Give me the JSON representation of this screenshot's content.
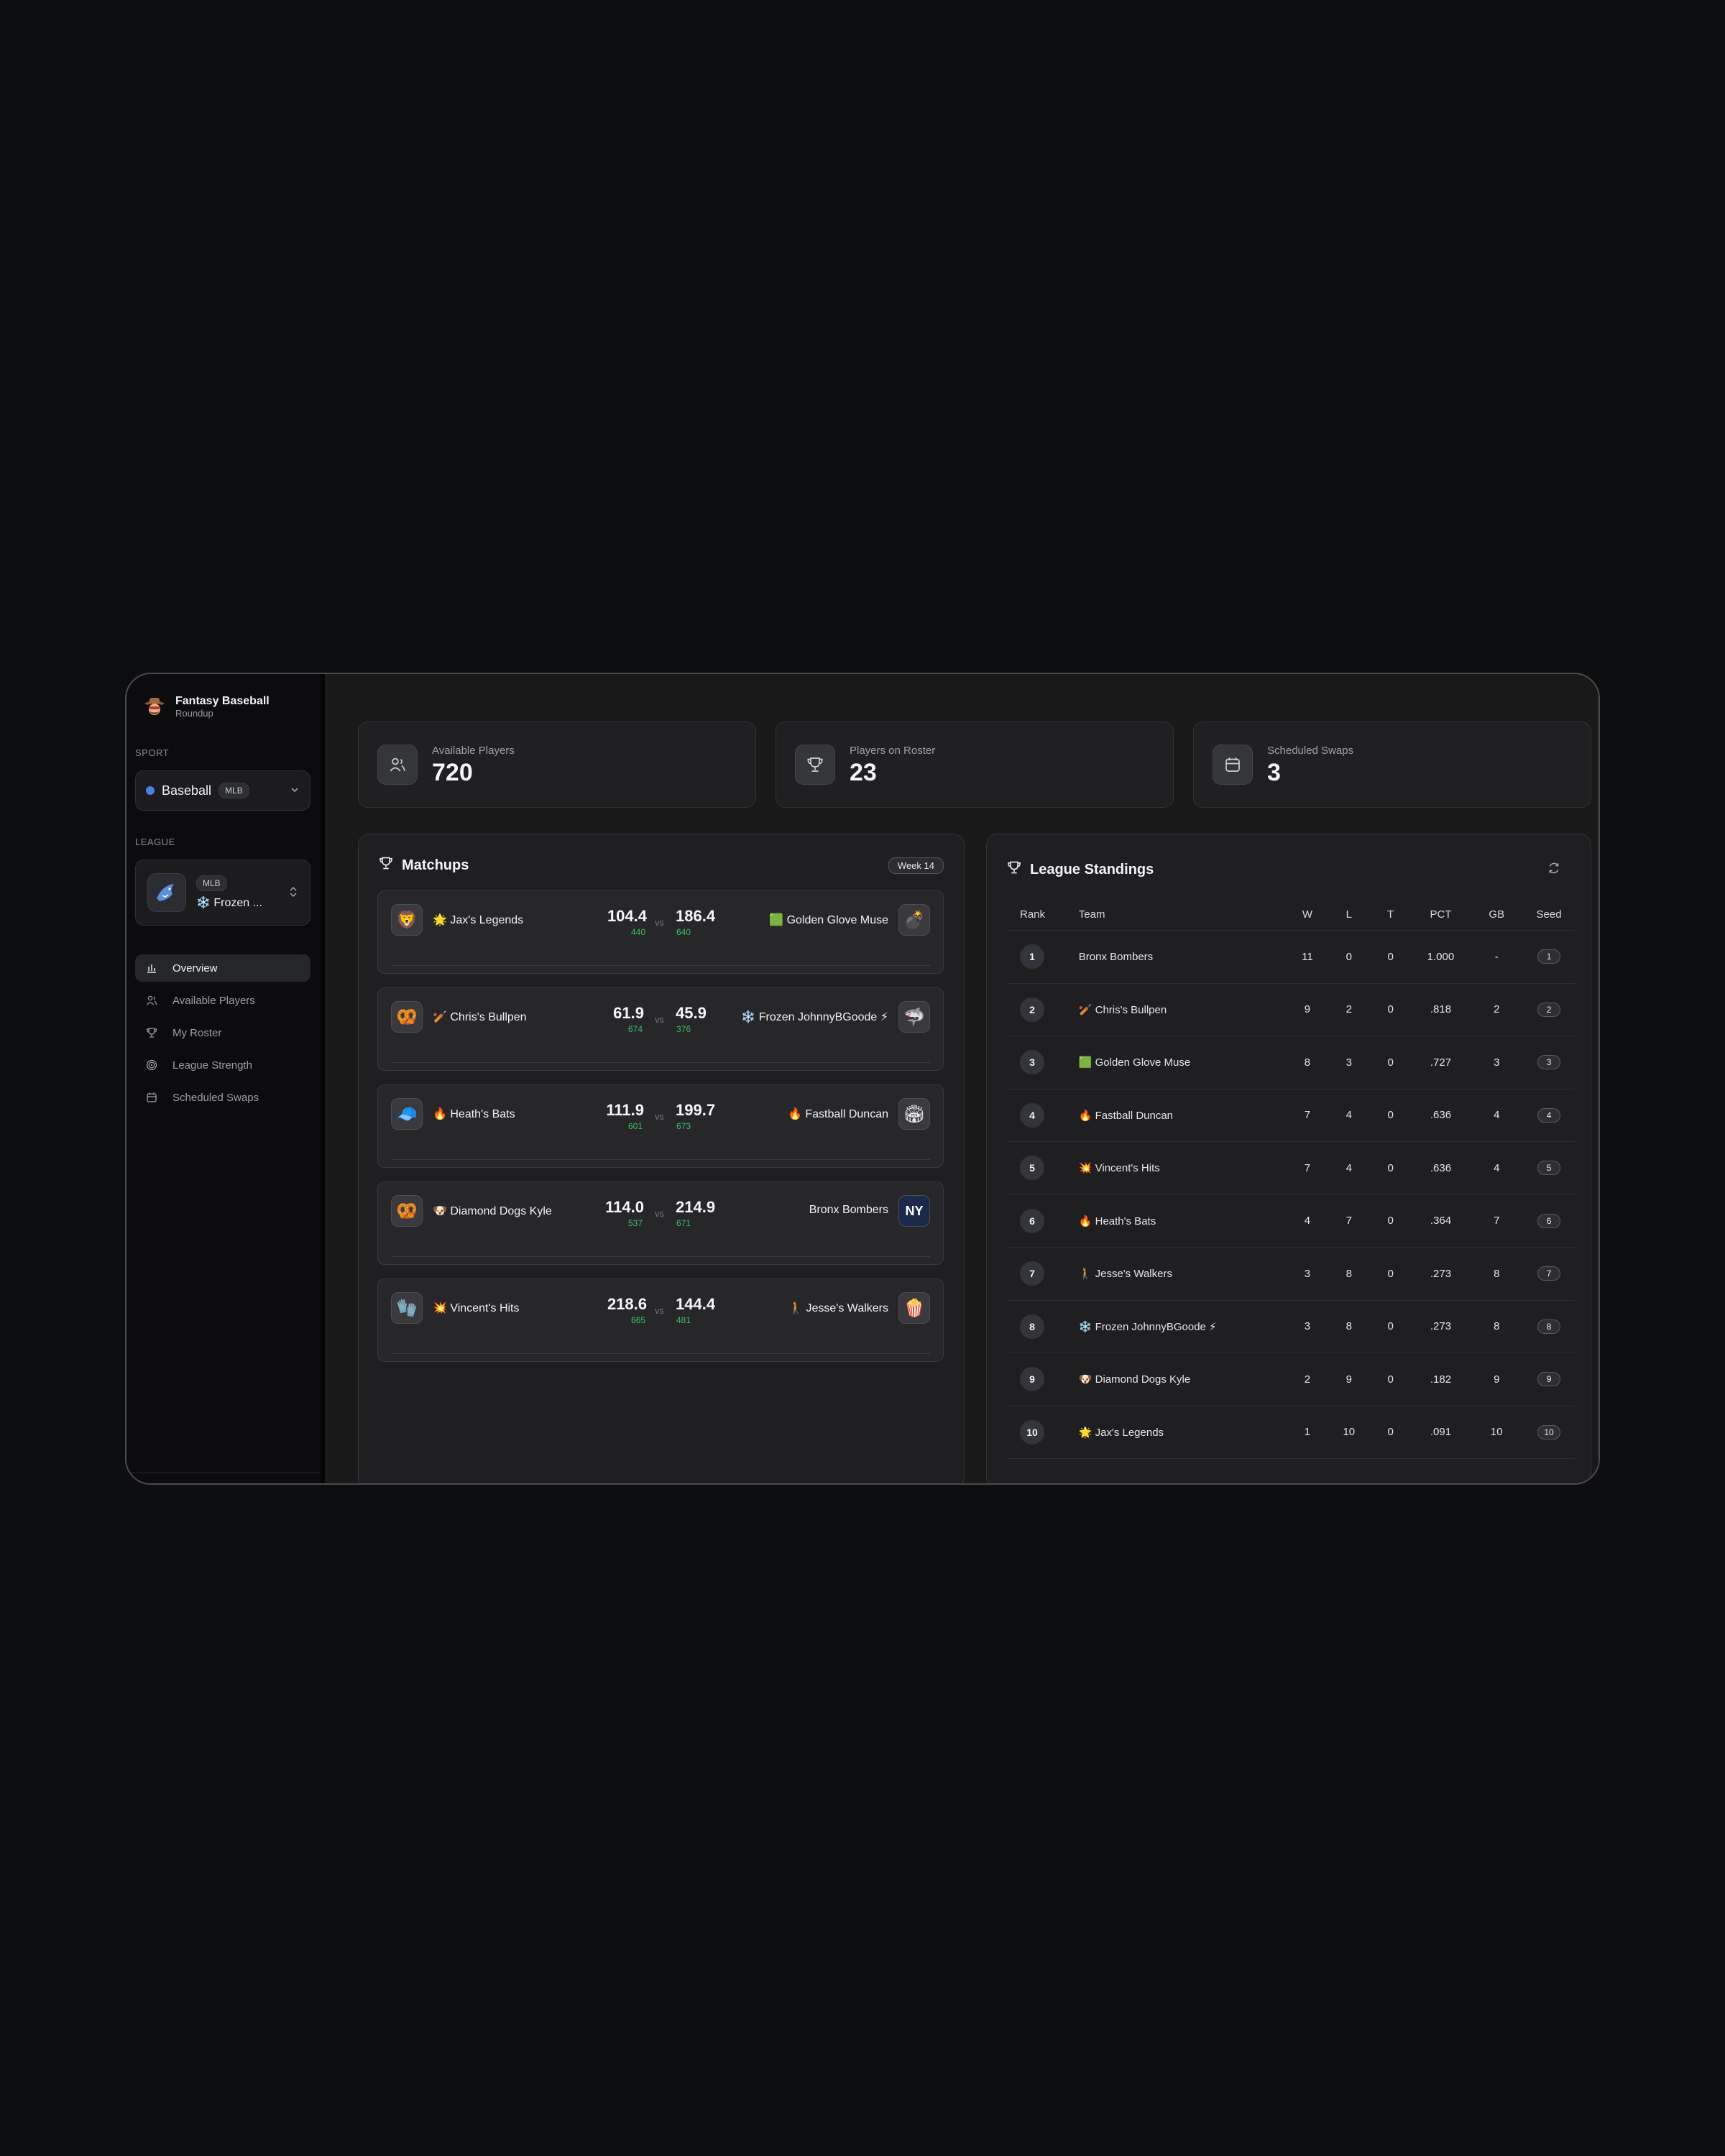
{
  "brand": {
    "title": "Fantasy Baseball",
    "subtitle": "Roundup",
    "logo_icon": "cowboy-logo-icon"
  },
  "sidebar": {
    "sport_label": "SPORT",
    "sport": {
      "name": "Baseball",
      "badge": "MLB",
      "dot_color": "#4a7fe0"
    },
    "league_label": "LEAGUE",
    "league": {
      "badge": "MLB",
      "name": "❄️ Frozen ..."
    },
    "nav": [
      {
        "label": "Overview",
        "icon": "bar-chart-icon",
        "active": true
      },
      {
        "label": "Available Players",
        "icon": "users-icon",
        "active": false
      },
      {
        "label": "My Roster",
        "icon": "trophy-icon",
        "active": false
      },
      {
        "label": "League Strength",
        "icon": "target-icon",
        "active": false
      },
      {
        "label": "Scheduled Swaps",
        "icon": "calendar-icon",
        "active": false
      }
    ]
  },
  "stats": [
    {
      "label": "Available Players",
      "value": "720",
      "icon": "users-icon"
    },
    {
      "label": "Players on Roster",
      "value": "23",
      "icon": "trophy-icon"
    },
    {
      "label": "Scheduled Swaps",
      "value": "3",
      "icon": "calendar-icon"
    }
  ],
  "matchups": {
    "title": "Matchups",
    "week": "Week 14",
    "vs_label": "vs",
    "games": [
      {
        "home": "🌟 Jax's Legends",
        "home_icon": "🦁",
        "home_score": "104.4",
        "home_proj": "440",
        "away_score": "186.4",
        "away_proj": "640",
        "away": "🟩 Golden Glove Muse",
        "away_icon": "💣"
      },
      {
        "home": "🏏 Chris's Bullpen",
        "home_icon": "🥨",
        "home_score": "61.9",
        "home_proj": "674",
        "away_score": "45.9",
        "away_proj": "376",
        "away": "❄️ Frozen JohnnyBGoode ⚡",
        "away_icon": "🦈"
      },
      {
        "home": "🔥 Heath's Bats",
        "home_icon": "🧢",
        "home_score": "111.9",
        "home_proj": "601",
        "away_score": "199.7",
        "away_proj": "673",
        "away": "🔥 Fastball Duncan",
        "away_icon": "🏟"
      },
      {
        "home": "🐶 Diamond Dogs Kyle",
        "home_icon": "🥨",
        "home_score": "114.0",
        "home_proj": "537",
        "away_score": "214.9",
        "away_proj": "671",
        "away": "Bronx Bombers",
        "away_icon": "NY"
      },
      {
        "home": "💥 Vincent's Hits",
        "home_icon": "🧤",
        "home_score": "218.6",
        "home_proj": "665",
        "away_score": "144.4",
        "away_proj": "481",
        "away": "🚶 Jesse's Walkers",
        "away_icon": "🍿"
      }
    ]
  },
  "standings": {
    "title": "League Standings",
    "columns": [
      "Rank",
      "Team",
      "W",
      "L",
      "T",
      "PCT",
      "GB",
      "Seed"
    ],
    "rows": [
      {
        "rank": "1",
        "team": "Bronx Bombers",
        "w": "11",
        "l": "0",
        "t": "0",
        "pct": "1.000",
        "gb": "-",
        "seed": "1"
      },
      {
        "rank": "2",
        "team": "🏏 Chris's Bullpen",
        "w": "9",
        "l": "2",
        "t": "0",
        "pct": ".818",
        "gb": "2",
        "seed": "2"
      },
      {
        "rank": "3",
        "team": "🟩 Golden Glove Muse",
        "w": "8",
        "l": "3",
        "t": "0",
        "pct": ".727",
        "gb": "3",
        "seed": "3"
      },
      {
        "rank": "4",
        "team": "🔥 Fastball Duncan",
        "w": "7",
        "l": "4",
        "t": "0",
        "pct": ".636",
        "gb": "4",
        "seed": "4"
      },
      {
        "rank": "5",
        "team": "💥 Vincent's Hits",
        "w": "7",
        "l": "4",
        "t": "0",
        "pct": ".636",
        "gb": "4",
        "seed": "5"
      },
      {
        "rank": "6",
        "team": "🔥 Heath's Bats",
        "w": "4",
        "l": "7",
        "t": "0",
        "pct": ".364",
        "gb": "7",
        "seed": "6"
      },
      {
        "rank": "7",
        "team": "🚶 Jesse's Walkers",
        "w": "3",
        "l": "8",
        "t": "0",
        "pct": ".273",
        "gb": "8",
        "seed": "7"
      },
      {
        "rank": "8",
        "team": "❄️ Frozen JohnnyBGoode ⚡",
        "w": "3",
        "l": "8",
        "t": "0",
        "pct": ".273",
        "gb": "8",
        "seed": "8"
      },
      {
        "rank": "9",
        "team": "🐶 Diamond Dogs Kyle",
        "w": "2",
        "l": "9",
        "t": "0",
        "pct": ".182",
        "gb": "9",
        "seed": "9"
      },
      {
        "rank": "10",
        "team": "🌟 Jax's Legends",
        "w": "1",
        "l": "10",
        "t": "0",
        "pct": ".091",
        "gb": "10",
        "seed": "10"
      }
    ]
  },
  "colors": {
    "accent_green": "#3fbf6a",
    "bg": "#0d0e10",
    "panel": "#1f1f21"
  }
}
